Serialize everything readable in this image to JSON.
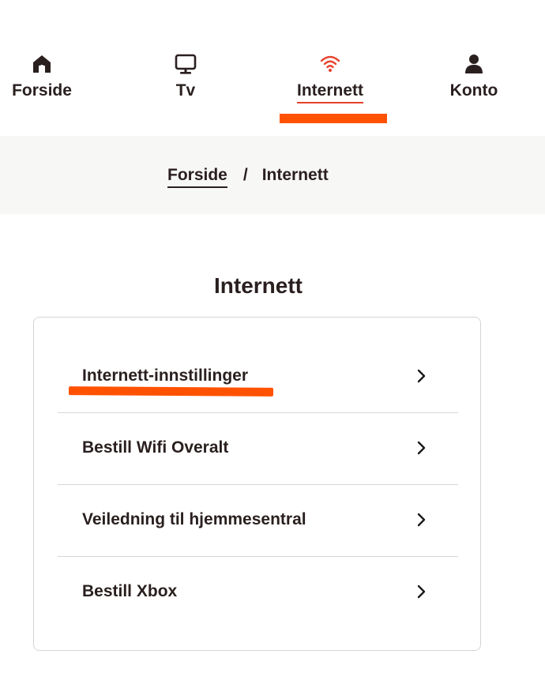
{
  "nav": {
    "items": [
      {
        "label": "Forside",
        "icon": "home-icon",
        "active": false
      },
      {
        "label": "Tv",
        "icon": "tv-icon",
        "active": false
      },
      {
        "label": "Internett",
        "icon": "wifi-icon",
        "active": true
      },
      {
        "label": "Konto",
        "icon": "user-icon",
        "active": false
      }
    ],
    "accent_color": "#ff5200",
    "active_icon_color": "#e8412b"
  },
  "breadcrumb": {
    "items": [
      {
        "label": "Forside"
      },
      {
        "label": "Internett"
      }
    ],
    "separator": "/"
  },
  "main": {
    "title": "Internett",
    "menu": [
      {
        "label": "Internett-innstillinger",
        "icon": "chevron-right-icon"
      },
      {
        "label": "Bestill Wifi Overalt",
        "icon": "chevron-right-icon"
      },
      {
        "label": "Veiledning til hjemmesentral",
        "icon": "chevron-right-icon"
      },
      {
        "label": "Bestill Xbox",
        "icon": "chevron-right-icon"
      }
    ]
  }
}
